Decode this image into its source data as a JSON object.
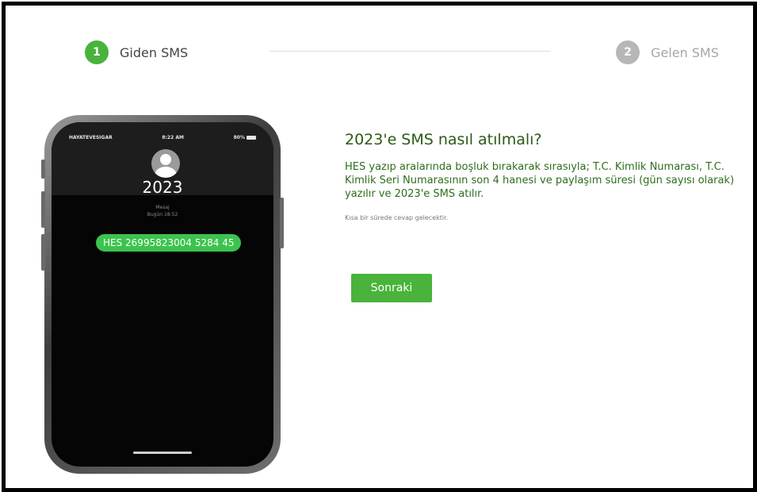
{
  "stepper": {
    "steps": [
      {
        "number": "1",
        "label": "Giden SMS",
        "state": "active"
      },
      {
        "number": "2",
        "label": "Gelen SMS",
        "state": "inactive"
      }
    ],
    "active_color": "#49b33c",
    "inactive_color": "#b7b7b7"
  },
  "phone": {
    "status": {
      "carrier": "HAYATEVESIGAR",
      "time": "8:22 AM",
      "battery": "80%"
    },
    "contact_name": "2023",
    "message_label": "Mesaj",
    "message_time": "Bugün 18:52",
    "message_text": "HES 26995823004 5284 45"
  },
  "content": {
    "title": "2023'e SMS nasıl atılmalı?",
    "description": "HES yazıp aralarında boşluk bırakarak sırasıyla; T.C. Kimlik Numarası, T.C. Kimlik Seri Numarasının son 4 hanesi ve paylaşım süresi (gün sayısı olarak) yazılır ve 2023'e SMS atılır.",
    "note": "Kısa bir sürede cevap gelecektir.",
    "next_button": "Sonraki"
  }
}
